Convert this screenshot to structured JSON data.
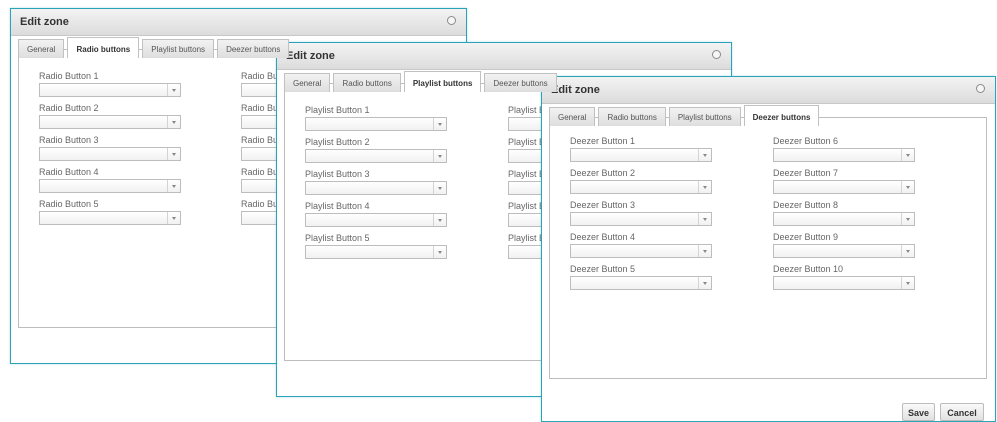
{
  "dialogs": [
    {
      "title": "Edit zone",
      "tabs": [
        "General",
        "Radio buttons",
        "Playlist buttons",
        "Deezer buttons"
      ],
      "active_tab": 1,
      "left_column": [
        "Radio Button 1",
        "Radio Button 2",
        "Radio Button 3",
        "Radio Button 4",
        "Radio Button 5"
      ],
      "right_column_visible": [
        "Radio But",
        "Radio But",
        "Radio But",
        "Radio But",
        "Radio But"
      ]
    },
    {
      "title": "Edit zone",
      "tabs": [
        "General",
        "Radio buttons",
        "Playlist buttons",
        "Deezer buttons"
      ],
      "active_tab": 2,
      "left_column": [
        "Playlist Button 1",
        "Playlist Button 2",
        "Playlist Button 3",
        "Playlist Button 4",
        "Playlist Button 5"
      ],
      "right_column_visible": [
        "Playlist Bu",
        "Playlist Bu",
        "Playlist Bu",
        "Playlist Bu",
        "Playlist Bu"
      ]
    },
    {
      "title": "Edit zone",
      "tabs": [
        "General",
        "Radio buttons",
        "Playlist buttons",
        "Deezer buttons"
      ],
      "active_tab": 3,
      "left_column": [
        "Deezer Button 1",
        "Deezer Button 2",
        "Deezer Button 3",
        "Deezer Button 4",
        "Deezer Button 5"
      ],
      "right_column": [
        "Deezer Button 6",
        "Deezer Button 7",
        "Deezer Button 8",
        "Deezer Button 9",
        "Deezer Button 10"
      ],
      "save_label": "Save",
      "cancel_label": "Cancel"
    }
  ],
  "icons": {
    "close": "close-circle-icon",
    "dropdown": "chevron-down-icon"
  },
  "colors": {
    "dialog_border": "#2aa3b8"
  }
}
